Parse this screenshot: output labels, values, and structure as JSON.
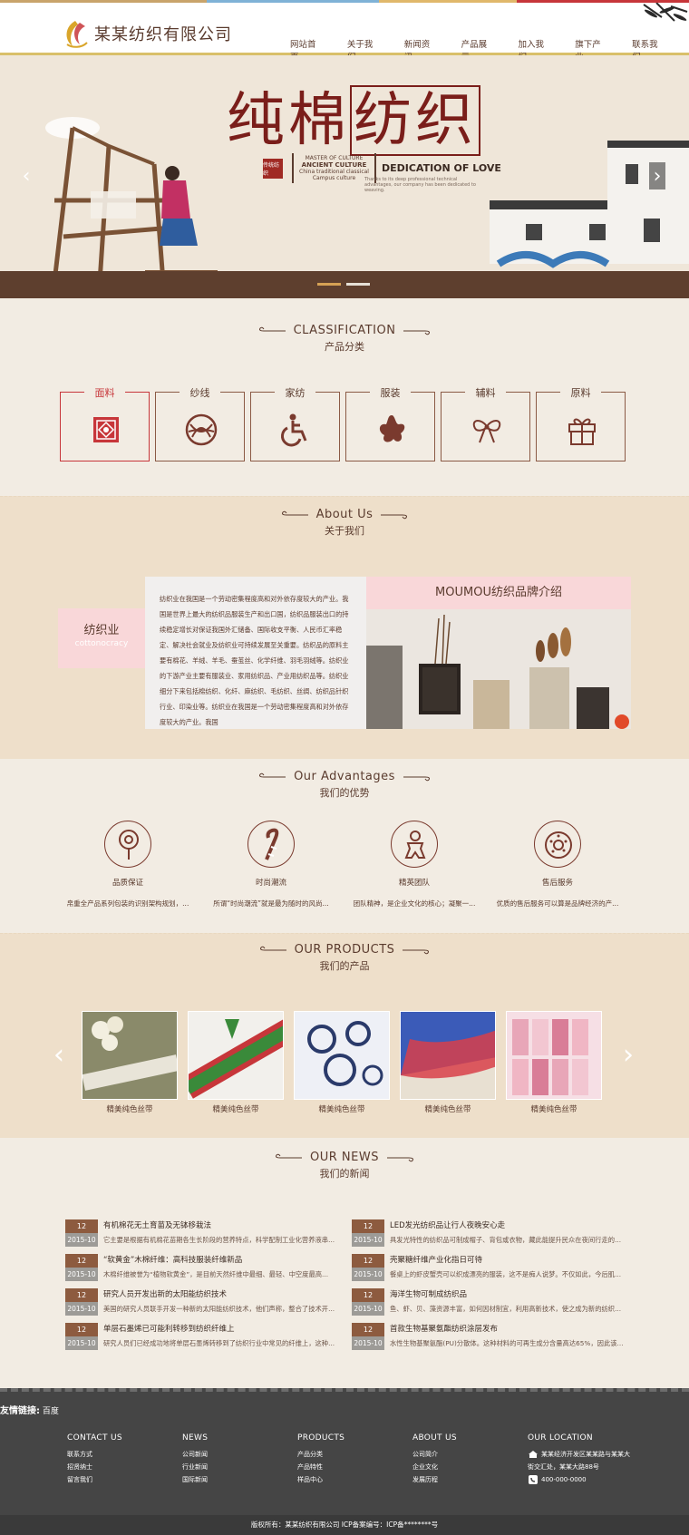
{
  "header": {
    "company_name": "某某纺织有限公司",
    "nav": [
      "网站首页",
      "关于我们",
      "新闻资讯",
      "产品展示",
      "加入我们",
      "旗下产业",
      "联系我们"
    ]
  },
  "banner": {
    "title_part1": "纯棉",
    "title_part2": "纺织",
    "seal_text": "传统纺织",
    "mid_line1": "MASTER OF CULTURE",
    "mid_line2": "ANCIENT CULTURE",
    "mid_line3": "China traditional classical",
    "mid_line4": "Campus culture",
    "dedication": "DEDICATION OF LOVE",
    "small_text": "Thanks to its deep professional technical advantages, our company has been dedicated to weaving."
  },
  "classification": {
    "en": "CLASSIFICATION",
    "cn": "产品分类",
    "items": [
      {
        "label": "面料",
        "icon": "fabric-pattern-icon",
        "active": true
      },
      {
        "label": "纱线",
        "icon": "yarn-ball-icon",
        "active": false
      },
      {
        "label": "家纺",
        "icon": "wheelchair-icon",
        "active": false
      },
      {
        "label": "服装",
        "icon": "star-blob-icon",
        "active": false
      },
      {
        "label": "辅料",
        "icon": "bow-icon",
        "active": false
      },
      {
        "label": "原料",
        "icon": "gift-box-icon",
        "active": false
      }
    ]
  },
  "about": {
    "en": "About Us",
    "cn": "关于我们",
    "label_title": "纺织业",
    "label_sub": "cottonocracy",
    "text": "纺织业在我国是一个劳动密集程度高和对外依存度较大的产业。我国是世界上最大的纺织品服装生产和出口国，纺织品服装出口的持续稳定增长对保证我国外汇储备、国际收支平衡、人民币汇率稳定、解决社会就业及纺织业可持续发展至关重要。纺织品的原料主要有棉花、羊绒、羊毛、蚕茧丝、化学纤维、羽毛羽绒等。纺织业的下游产业主要有服装业、家用纺织品、产业用纺织品等。纺织业细分下来包括棉纺织、化纤、麻纺织、毛纺织、丝绸、纺织品针织行业、印染业等。纺织业在我国是一个劳动密集程度高和对外依存度较大的产业。我国",
    "brand_title": "MOUMOU纺织品牌介绍"
  },
  "advantages": {
    "en": "Our Advantages",
    "cn": "我们的优势",
    "items": [
      {
        "title": "品质保证",
        "desc": "帛重全产品系列包装的识别架构规划，...",
        "icon": "lollipop-icon"
      },
      {
        "title": "时尚潮流",
        "desc": "所谓“时尚潮流”就是最为随时的风尚...",
        "icon": "candy-cane-icon"
      },
      {
        "title": "精英团队",
        "desc": "团队精神，是企业文化的核心；凝聚一...",
        "icon": "gingerbread-icon"
      },
      {
        "title": "售后服务",
        "desc": "优质的售后服务可以算是品牌经济的产...",
        "icon": "donut-icon"
      }
    ]
  },
  "products": {
    "en": "OUR PRODUCTS",
    "cn": "我们的产品",
    "items": [
      {
        "name": "精美纯色丝带"
      },
      {
        "name": "精美纯色丝带"
      },
      {
        "name": "精美纯色丝带"
      },
      {
        "name": "精美纯色丝带"
      },
      {
        "name": "精美纯色丝带"
      }
    ]
  },
  "news": {
    "en": "OUR NEWS",
    "cn": "我们的新闻",
    "left": [
      {
        "day": "12",
        "ym": "2015-10",
        "title": "有机棉花无土育苗及无钵移栽法",
        "summary": "它主要是根据有机棉花苗期各生长阶段的营养特点，科学配制工业化营养液串..."
      },
      {
        "day": "12",
        "ym": "2015-10",
        "title": "“软黄金”木棉纤维：高科技服装纤维新品",
        "summary": "木棉纤维被誉为“植物软黄金”，是目前天然纤维中最细、最轻、中空度最高..."
      },
      {
        "day": "12",
        "ym": "2015-10",
        "title": "研究人员开发出新的太阳能纺织技术",
        "summary": "美国的研究人员联手开发一种新的太阳能纺织技术，他们声称，整合了技术开..."
      },
      {
        "day": "12",
        "ym": "2015-10",
        "title": "单层石墨烯已可能利转移到纺织纤维上",
        "summary": "研究人员们已经成功地将单层石墨烯转移到了纺织行业中常见的纤维上，这种..."
      }
    ],
    "right": [
      {
        "day": "12",
        "ym": "2015-10",
        "title": "LED发光纺织品让行人夜晚安心走",
        "summary": "具发光特性的纺织品可制成帽子、背包或衣物，藏此能提升民众在夜间行走的..."
      },
      {
        "day": "12",
        "ym": "2015-10",
        "title": "壳聚糖纤维产业化指日可待",
        "summary": "餐桌上的虾皮蟹壳可以织成漂亮的服装，这不是痴人说梦。不仅如此，今后肌..."
      },
      {
        "day": "12",
        "ym": "2015-10",
        "title": "海洋生物可制成纺织品",
        "summary": "鱼、虾、贝、藻资源丰富，如何因材制宜，利用高新技术，使之成为新的纺织..."
      },
      {
        "day": "12",
        "ym": "2015-10",
        "title": "首款生物基聚氨酯纺织涂层发布",
        "summary": "水性生物基聚氨酯(PU)分散体。这种材料的可再生成分含量高达65%，因此该..."
      }
    ]
  },
  "footer": {
    "links_label": "友情链接:",
    "links": [
      "百度"
    ],
    "columns": [
      {
        "title": "CONTACT US",
        "items": [
          "联系方式",
          "招贤纳士",
          "留言我们"
        ]
      },
      {
        "title": "NEWS",
        "items": [
          "公司新闻",
          "行业新闻",
          "国际新闻"
        ]
      },
      {
        "title": "PRODUCTS",
        "items": [
          "产品分类",
          "产品特性",
          "样品中心"
        ]
      },
      {
        "title": "ABOUT US",
        "items": [
          "公司简介",
          "企业文化",
          "发展历程"
        ]
      }
    ],
    "location_title": "OUR LOCATION",
    "address_line1": "某某经济开发区某某路与某某大",
    "address_line2": "街交汇处，某某大路88号",
    "phone": "400-000-0000",
    "copyright": "版权所有：某某纺织有限公司    ICP备案编号：ICP备********号"
  }
}
